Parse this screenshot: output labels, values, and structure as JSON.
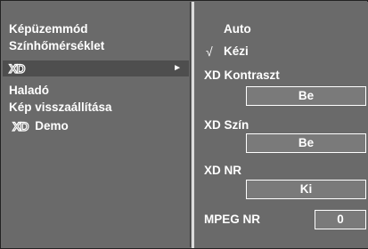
{
  "menu": {
    "items": [
      {
        "label": "Képüzemmód"
      },
      {
        "label": "Színhőmérséklet"
      },
      {
        "label": "XD",
        "logo": true,
        "has_submenu": true
      },
      {
        "label": "Haladó"
      },
      {
        "label": "Kép visszaállítása"
      },
      {
        "label": "Demo",
        "logo_prefix": "XD"
      }
    ],
    "submenu_arrow": "►"
  },
  "submenu": {
    "options": [
      {
        "label": "Auto",
        "checked": false
      },
      {
        "label": "Kézi",
        "checked": true
      }
    ],
    "check_mark": "√",
    "settings": [
      {
        "label": "XD Kontraszt",
        "value": "Be"
      },
      {
        "label": "XD Szín",
        "value": "Be"
      },
      {
        "label": "XD NR",
        "value": "Ki"
      },
      {
        "label": "MPEG NR",
        "value": "0"
      }
    ]
  },
  "colors": {
    "panel": "#6a6a6a",
    "selected_row": "#4e4e4e",
    "divider": "#dcdcdc",
    "text": "#ffffff"
  }
}
